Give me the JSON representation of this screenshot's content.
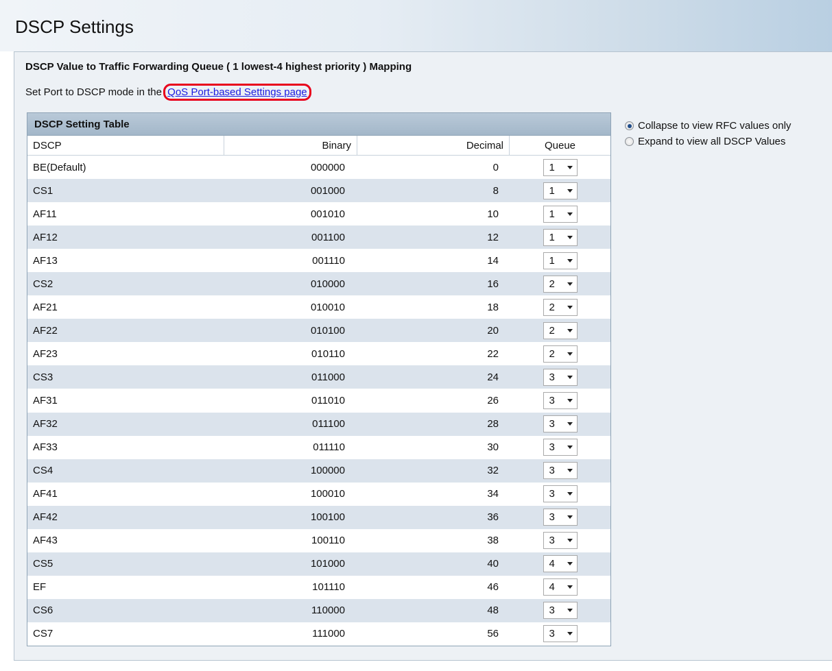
{
  "page": {
    "title": "DSCP Settings"
  },
  "section": {
    "title": "DSCP Value to Traffic Forwarding Queue ( 1 lowest-4 highest priority ) Mapping",
    "hint_prefix": "Set Port to DSCP mode in the",
    "hint_link": "QoS Port-based Settings page"
  },
  "table": {
    "caption": "DSCP Setting Table",
    "columns": {
      "dscp": "DSCP",
      "binary": "Binary",
      "decimal": "Decimal",
      "queue": "Queue"
    },
    "rows": [
      {
        "dscp": "BE(Default)",
        "binary": "000000",
        "decimal": "0",
        "queue": "1"
      },
      {
        "dscp": "CS1",
        "binary": "001000",
        "decimal": "8",
        "queue": "1"
      },
      {
        "dscp": "AF11",
        "binary": "001010",
        "decimal": "10",
        "queue": "1"
      },
      {
        "dscp": "AF12",
        "binary": "001100",
        "decimal": "12",
        "queue": "1"
      },
      {
        "dscp": "AF13",
        "binary": "001110",
        "decimal": "14",
        "queue": "1"
      },
      {
        "dscp": "CS2",
        "binary": "010000",
        "decimal": "16",
        "queue": "2"
      },
      {
        "dscp": "AF21",
        "binary": "010010",
        "decimal": "18",
        "queue": "2"
      },
      {
        "dscp": "AF22",
        "binary": "010100",
        "decimal": "20",
        "queue": "2"
      },
      {
        "dscp": "AF23",
        "binary": "010110",
        "decimal": "22",
        "queue": "2"
      },
      {
        "dscp": "CS3",
        "binary": "011000",
        "decimal": "24",
        "queue": "3"
      },
      {
        "dscp": "AF31",
        "binary": "011010",
        "decimal": "26",
        "queue": "3"
      },
      {
        "dscp": "AF32",
        "binary": "011100",
        "decimal": "28",
        "queue": "3"
      },
      {
        "dscp": "AF33",
        "binary": "011110",
        "decimal": "30",
        "queue": "3"
      },
      {
        "dscp": "CS4",
        "binary": "100000",
        "decimal": "32",
        "queue": "3"
      },
      {
        "dscp": "AF41",
        "binary": "100010",
        "decimal": "34",
        "queue": "3"
      },
      {
        "dscp": "AF42",
        "binary": "100100",
        "decimal": "36",
        "queue": "3"
      },
      {
        "dscp": "AF43",
        "binary": "100110",
        "decimal": "38",
        "queue": "3"
      },
      {
        "dscp": "CS5",
        "binary": "101000",
        "decimal": "40",
        "queue": "4"
      },
      {
        "dscp": "EF",
        "binary": "101110",
        "decimal": "46",
        "queue": "4"
      },
      {
        "dscp": "CS6",
        "binary": "110000",
        "decimal": "48",
        "queue": "3"
      },
      {
        "dscp": "CS7",
        "binary": "111000",
        "decimal": "56",
        "queue": "3"
      }
    ]
  },
  "view_options": {
    "collapse_label": "Collapse to view RFC values only",
    "expand_label": "Expand to view all DSCP Values",
    "selected": "collapse"
  }
}
